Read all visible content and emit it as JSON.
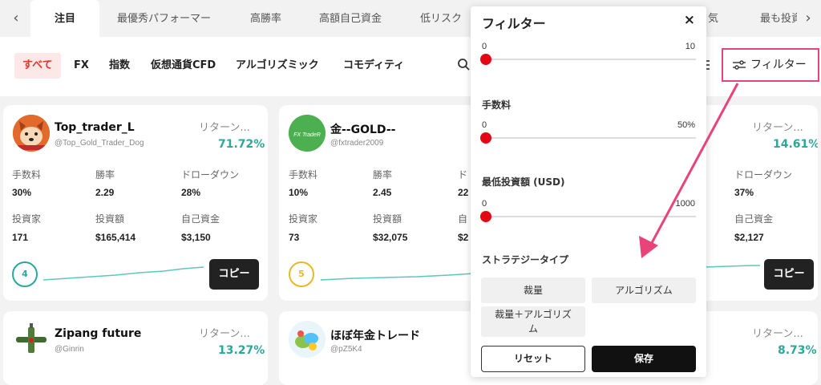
{
  "tabs": {
    "prev_arrow": "‹",
    "next_arrow": "›",
    "items": [
      "注目",
      "最優秀パフォーマー",
      "高勝率",
      "高額自己資金",
      "低リスク",
      "気",
      "最も投資"
    ]
  },
  "categories": [
    "すべて",
    "FX",
    "指数",
    "仮想通貨CFD",
    "アルゴリズミック",
    "コモディティ"
  ],
  "filter_button_label": "フィルター",
  "cards": [
    {
      "name": "Top_trader_L",
      "handle": "@Top_Gold_Trader_Dog",
      "return_label": "リターン...",
      "return_value": "71.72%",
      "stats": [
        {
          "label": "手数料",
          "value": "30%"
        },
        {
          "label": "勝率",
          "value": "2.29"
        },
        {
          "label": "ドローダウン",
          "value": "28%"
        },
        {
          "label": "投資家",
          "value": "171"
        },
        {
          "label": "投資額",
          "value": "$165,414"
        },
        {
          "label": "自己資金",
          "value": "$3,150"
        }
      ],
      "rank": "4",
      "copy_label": "コピー"
    },
    {
      "name": "金--GOLD--",
      "handle": "@fxtrader2009",
      "avatar_text": "FX TradeR",
      "return_label": "リターン...",
      "return_value": "14.61%",
      "stats_left": [
        {
          "label": "手数料",
          "value": "10%"
        },
        {
          "label": "勝率",
          "value": "2.45"
        },
        {
          "label": "ド",
          "value": "22"
        },
        {
          "label": "投資家",
          "value": "73"
        },
        {
          "label": "投資額",
          "value": "$32,075"
        },
        {
          "label": "自",
          "value": "$2"
        }
      ],
      "stats_right": [
        {
          "label": "ドローダウン",
          "value": "37%"
        },
        {
          "label": "自己資金",
          "value": "$2,127"
        }
      ],
      "rank": "5",
      "copy_label": "コピー"
    },
    {
      "name": "Zipang future",
      "handle": "@Ginrin",
      "return_label": "リターン...",
      "return_value": "13.27%"
    },
    {
      "name": "ほぼ年金トレード",
      "handle": "@pZ5K4",
      "return_label": "リターン...",
      "return_value": "8.73%"
    }
  ],
  "filter_panel": {
    "title": "フィルター",
    "close": "×",
    "slider1": {
      "min": "0",
      "max": "10"
    },
    "fee_label": "手数料",
    "slider2": {
      "min": "0",
      "max": "50%"
    },
    "min_invest_label": "最低投資額 (USD)",
    "slider3": {
      "min": "0",
      "max": "1000"
    },
    "strategy_label": "ストラテジータイプ",
    "strategies": [
      "裁量",
      "アルゴリズム",
      "裁量＋アルゴリズム"
    ],
    "reset_label": "リセット",
    "save_label": "保存"
  },
  "colors": {
    "accent_red": "#e5352b",
    "return_green": "#2aa89a",
    "highlight_pink": "#e8447a",
    "rank_teal": "#2aa89a",
    "rank_gold": "#e8b923"
  }
}
